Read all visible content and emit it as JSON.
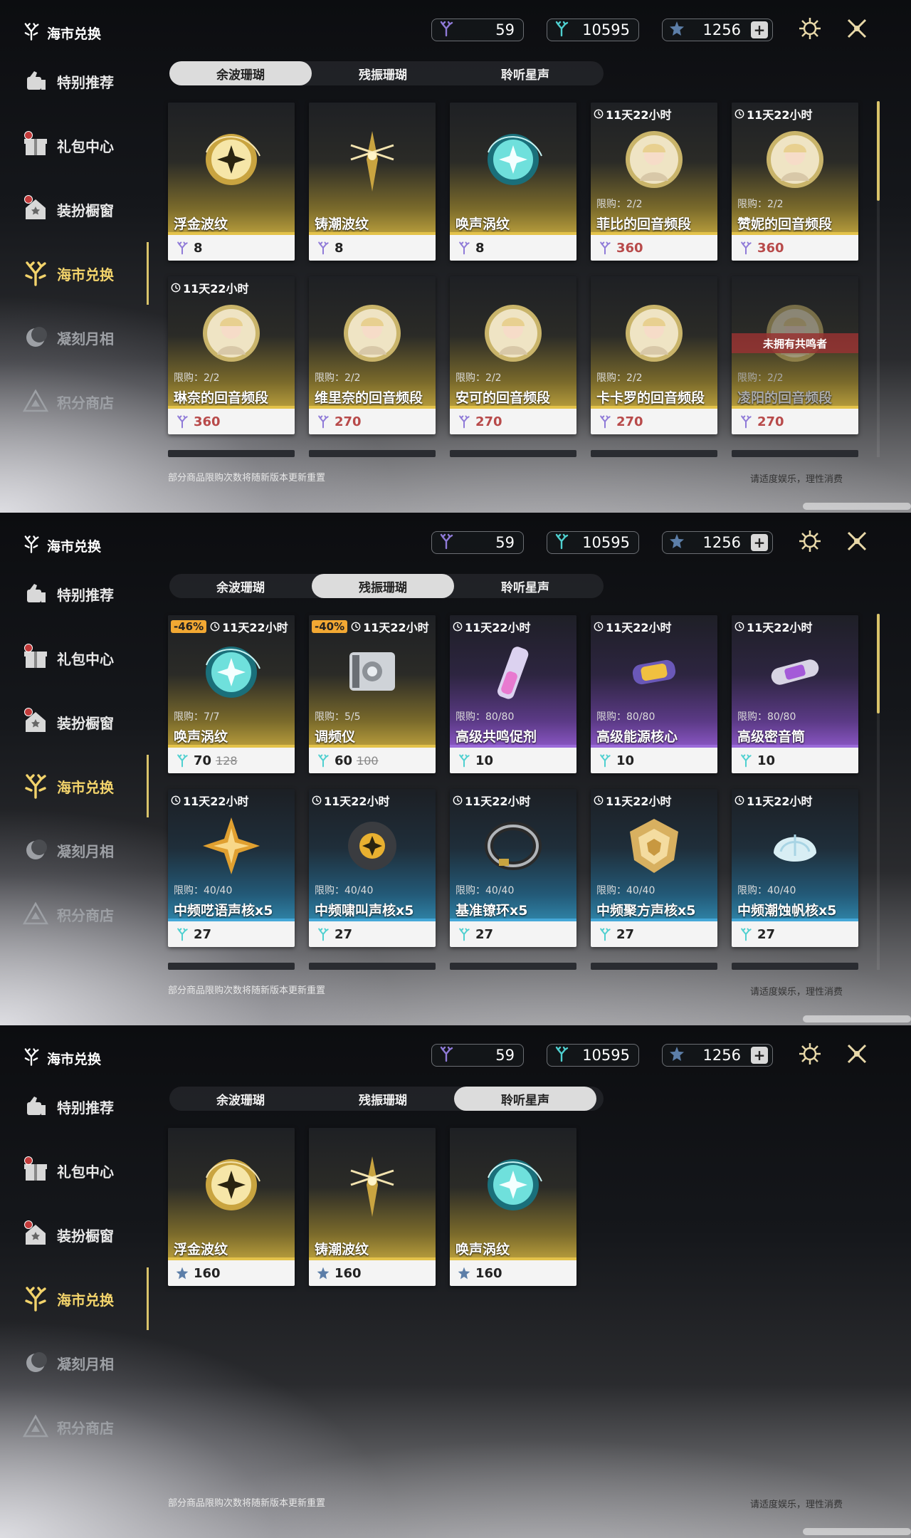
{
  "sidebar": {
    "brand": "海市兑换",
    "items": [
      "特别推荐",
      "礼包中心",
      "装扮橱窗",
      "海市兑换",
      "凝刻月相",
      "积分商店"
    ]
  },
  "currency": {
    "c1": "59",
    "c2": "10595",
    "c3": "1256",
    "plus": "+"
  },
  "tabs": [
    "余波珊瑚",
    "残振珊瑚",
    "聆听星声"
  ],
  "footer": {
    "left": "部分商品限购次数将随新版本更新重置",
    "right": "请适度娱乐，理性消费"
  },
  "panels": [
    {
      "active_tab": 0,
      "cards": [
        {
          "name": "浮金波纹",
          "price": "8",
          "theme": "gold",
          "icon": "golden-orb-icon"
        },
        {
          "name": "铸潮波纹",
          "price": "8",
          "theme": "gold",
          "icon": "golden-blade-icon"
        },
        {
          "name": "唤声涡纹",
          "price": "8",
          "theme": "gold",
          "icon": "teal-orb-icon"
        },
        {
          "name": "菲比的回音频段",
          "price": "360",
          "red": true,
          "timer": "11天22小时",
          "limit": "限购：2/2",
          "theme": "gold",
          "icon": "character-portrait-icon"
        },
        {
          "name": "赞妮的回音频段",
          "price": "360",
          "red": true,
          "timer": "11天22小时",
          "limit": "限购：2/2",
          "theme": "gold",
          "icon": "character-portrait-icon"
        },
        {
          "name": "琳奈的回音频段",
          "price": "360",
          "red": true,
          "timer": "11天22小时",
          "limit": "限购：2/2",
          "theme": "gold",
          "icon": "character-portrait-icon"
        },
        {
          "name": "维里奈的回音频段",
          "price": "270",
          "red": true,
          "limit": "限购：2/2",
          "theme": "gold",
          "icon": "character-portrait-icon"
        },
        {
          "name": "安可的回音频段",
          "price": "270",
          "red": true,
          "limit": "限购：2/2",
          "theme": "gold",
          "icon": "character-portrait-icon"
        },
        {
          "name": "卡卡罗的回音频段",
          "price": "270",
          "red": true,
          "limit": "限购：2/2",
          "theme": "gold",
          "icon": "character-portrait-icon"
        },
        {
          "name": "凌阳的回音频段",
          "price": "270",
          "red": true,
          "limit": "限购：2/2",
          "theme": "gold",
          "icon": "character-portrait-icon",
          "locked": "未拥有共鸣者"
        }
      ]
    },
    {
      "active_tab": 1,
      "cards": [
        {
          "name": "唤声涡纹",
          "price": "70",
          "old": "128",
          "discount": "-46%",
          "timer": "11天22小时",
          "limit": "限购：7/7",
          "theme": "gold",
          "icon": "teal-orb-icon"
        },
        {
          "name": "调频仪",
          "price": "60",
          "old": "100",
          "discount": "-40%",
          "timer": "11天22小时",
          "limit": "限购：5/5",
          "theme": "gold",
          "icon": "tuner-device-icon"
        },
        {
          "name": "高级共鸣促剂",
          "price": "10",
          "timer": "11天22小时",
          "limit": "限购：80/80",
          "theme": "purple",
          "icon": "vial-icon"
        },
        {
          "name": "高级能源核心",
          "price": "10",
          "timer": "11天22小时",
          "limit": "限购：80/80",
          "theme": "purple",
          "icon": "energy-core-icon"
        },
        {
          "name": "高级密音筒",
          "price": "10",
          "timer": "11天22小时",
          "limit": "限购：80/80",
          "theme": "purple",
          "icon": "sealed-tube-icon"
        },
        {
          "name": "中频呓语声核x5",
          "price": "27",
          "timer": "11天22小时",
          "limit": "限购：40/40",
          "theme": "blue",
          "icon": "gold-star-core-icon"
        },
        {
          "name": "中频啸叫声核x5",
          "price": "27",
          "timer": "11天22小时",
          "limit": "限购：40/40",
          "theme": "blue",
          "icon": "dark-core-icon"
        },
        {
          "name": "基准镣环x5",
          "price": "27",
          "timer": "11天22小时",
          "limit": "限购：40/40",
          "theme": "blue",
          "icon": "ring-icon"
        },
        {
          "name": "中频聚方声核x5",
          "price": "27",
          "timer": "11天22小时",
          "limit": "限购：40/40",
          "theme": "blue",
          "icon": "gold-polygon-icon"
        },
        {
          "name": "中频潮蚀帆核x5",
          "price": "27",
          "timer": "11天22小时",
          "limit": "限购：40/40",
          "theme": "blue",
          "icon": "shell-icon"
        }
      ]
    },
    {
      "active_tab": 2,
      "cards": [
        {
          "name": "浮金波纹",
          "price": "160",
          "theme": "gold",
          "icon": "golden-orb-icon",
          "star": true
        },
        {
          "name": "铸潮波纹",
          "price": "160",
          "theme": "gold",
          "icon": "golden-blade-icon",
          "star": true
        },
        {
          "name": "唤声涡纹",
          "price": "160",
          "theme": "gold",
          "icon": "teal-orb-icon",
          "star": true
        }
      ]
    }
  ],
  "colors": {
    "accent": "#f2d36b",
    "gold_bar": "#e3c24a",
    "purple_bar": "#9a6ad8",
    "blue_bar": "#45a8d8",
    "price_red": "#b84a4a"
  }
}
